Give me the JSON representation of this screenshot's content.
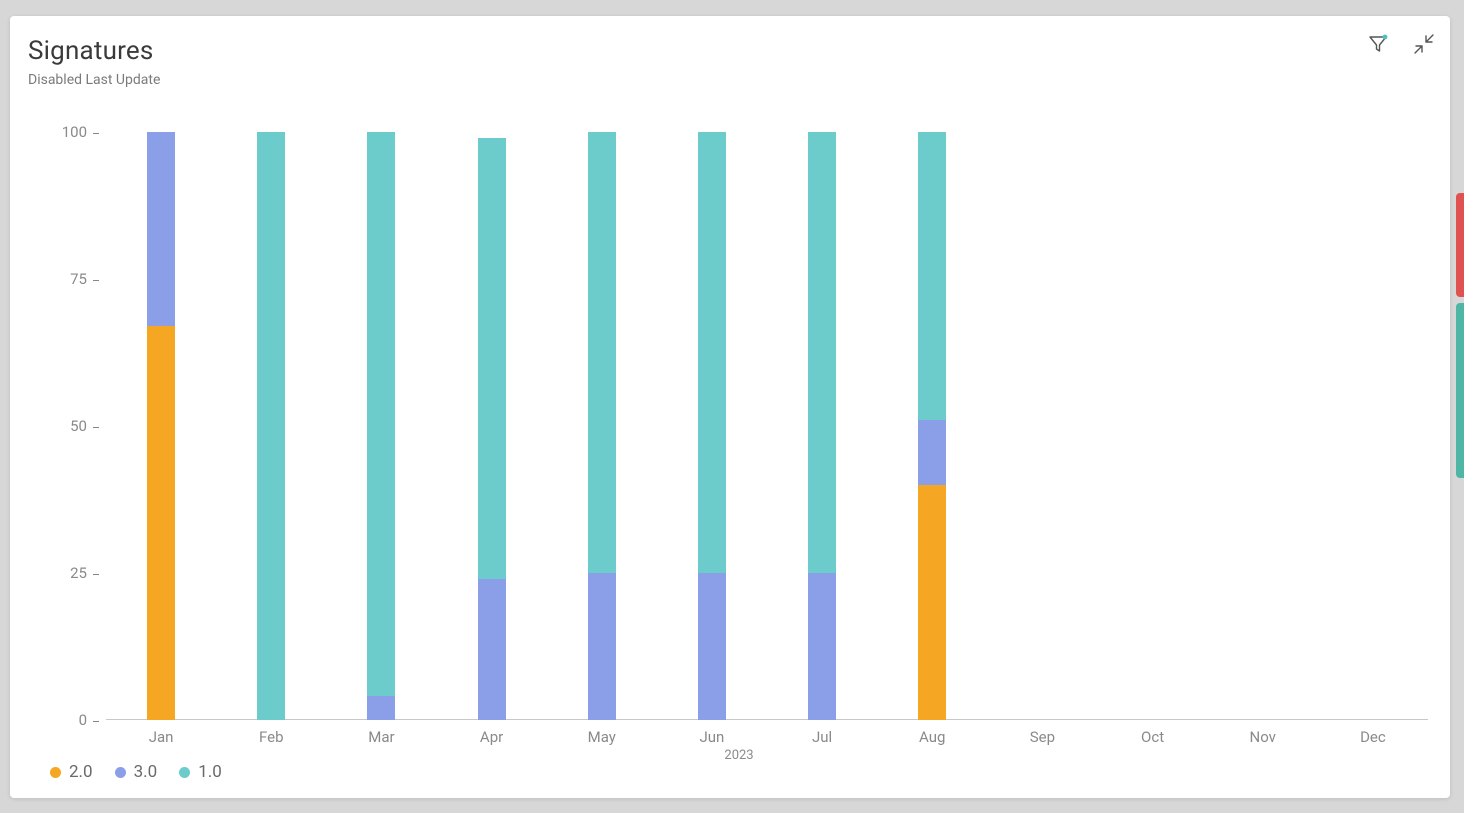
{
  "header": {
    "title": "Signatures",
    "subtitle": "Disabled Last Update"
  },
  "toolbar": {
    "filter_name": "Filter",
    "expand_name": "Collapse"
  },
  "chart_data": {
    "type": "bar",
    "stacked": true,
    "categories": [
      "Jan",
      "Feb",
      "Mar",
      "Apr",
      "May",
      "Jun",
      "Jul",
      "Aug",
      "Sep",
      "Oct",
      "Nov",
      "Dec"
    ],
    "series": [
      {
        "name": "2.0",
        "color": "#f5a623",
        "values": [
          67,
          0,
          0,
          0,
          0,
          0,
          0,
          40,
          0,
          0,
          0,
          0
        ]
      },
      {
        "name": "3.0",
        "color": "#8b9fe8",
        "values": [
          33,
          0,
          4,
          24,
          25,
          25,
          25,
          11,
          0,
          0,
          0,
          0
        ]
      },
      {
        "name": "1.0",
        "color": "#6ccccb",
        "values": [
          0,
          100,
          96,
          75,
          75,
          75,
          75,
          49,
          0,
          0,
          0,
          0
        ]
      }
    ],
    "title": "Signatures",
    "xlabel": "2023",
    "ylabel": "",
    "ylim": [
      0,
      100
    ],
    "yticks": [
      0,
      25,
      50,
      75,
      100
    ]
  }
}
